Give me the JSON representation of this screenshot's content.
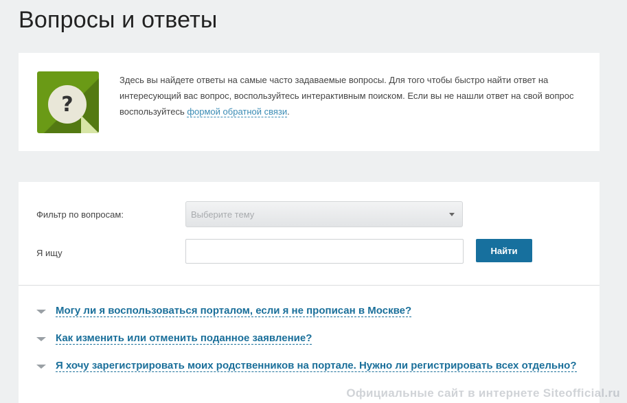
{
  "page": {
    "title": "Вопросы и ответы"
  },
  "info": {
    "text_before_link": "Здесь вы найдете ответы на самые часто задаваемые вопросы. Для того чтобы быстро найти ответ на интересующий вас вопрос, воспользуйтесь интерактивным поиском. Если вы не нашли ответ на свой вопрос воспользуйтесь ",
    "link_text": "формой обратной связи",
    "text_after_link": ".",
    "icon": "question-mark-icon",
    "icon_color": "#6a9a16"
  },
  "search": {
    "filter_label": "Фильтр по вопросам:",
    "filter_select_value": "Выберите тему",
    "query_label": "Я ищу",
    "query_value": "",
    "find_button_label": "Найти",
    "button_color": "#17709e"
  },
  "faq": {
    "link_color": "#1a6f9a",
    "items": [
      {
        "question": "Могу ли я воспользоваться порталом, если я не прописан в Москве?"
      },
      {
        "question": "Как изменить или отменить поданное заявление?"
      },
      {
        "question": "Я хочу зарегистрировать моих родственников на портале. Нужно ли регистрировать всех отдельно?"
      }
    ]
  },
  "watermark": {
    "text": "Официальные сайт в интернете Siteofficial.ru"
  }
}
